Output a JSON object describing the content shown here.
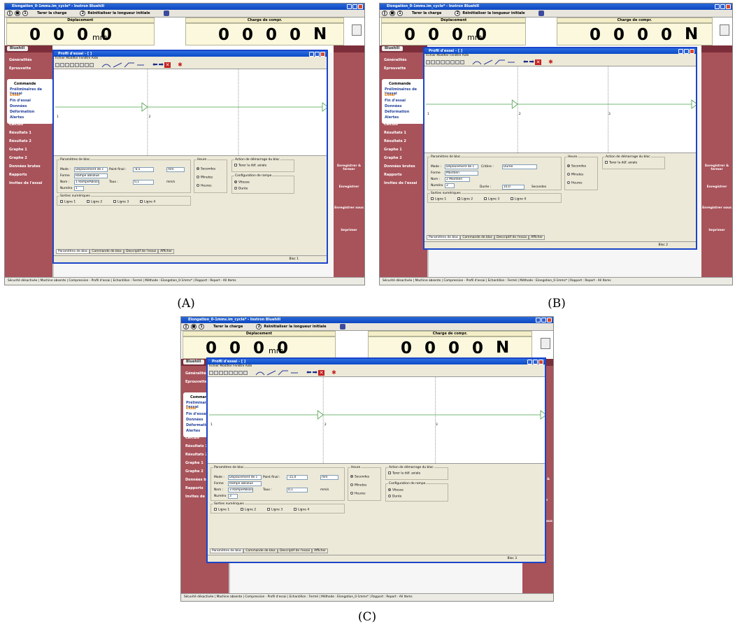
{
  "app": {
    "window_title": "Elongation_0-1mms.im_cycle* - Instron Bluehill",
    "toolbar": {
      "reset_load": "Tarer la charge",
      "reset_length": "Réinitialiser la longueur initiale",
      "step1": "1",
      "step2": "2"
    },
    "displacement": {
      "header": "Déplacement",
      "value": "0 0 0 0",
      "unit": "mm"
    },
    "load": {
      "header": "Charge de compr.",
      "value": "0 0 0 0",
      "unit": "N"
    },
    "nav": {
      "bluehill": "Bluehill",
      "items": [
        "Généralités",
        "Eprouvette",
        "Commande",
        "Calculs",
        "Résultats 1",
        "Résultats 2",
        "Graphe 1",
        "Graphe 2",
        "Données brutes",
        "Rapports",
        "Invites de l'essai"
      ],
      "subitems": [
        "Préliminaires de l'essai",
        "Essai",
        "Fin d'essai",
        "Données",
        "Déformation",
        "Alertes"
      ]
    },
    "right": {
      "save_close": "Enregistrer & fermer",
      "save": "Enregistrer",
      "save_as": "Enregistrer sous",
      "print": "Imprimer"
    },
    "status": "Sécurité désactivée  |  Machine absente  |  Compression - Profil d'essai  |  Echantillon : Fermé  |  Méthode : Elongation_0-1mms*  |  Rapport : Report - All Items"
  },
  "dialog": {
    "title": "Profil d'essai - [ ]",
    "menu": "Fichier   Modifier   Fenêtre   Aide",
    "params_legend": "Paramètres de bloc",
    "mode_label": "Mode :",
    "final_label": "Point final :",
    "forme_label": "Forme",
    "nom_label": "Nom :",
    "taux_label": "Taux :",
    "numero_label": "Numéro",
    "critere_label": "Critère :",
    "duree_label": "Durée :",
    "heure_legend": "Heure",
    "sec": "Secondes",
    "min": "Minutes",
    "hrs": "Heures",
    "action_legend": "Action de démarrage du bloc",
    "tare_chk": "Tarer la déf. axiale",
    "config_legend": "Configuration de rampe",
    "vitesse": "Vitesse",
    "duree": "Durée",
    "sorties_legend": "Sorties numériques",
    "lignes": [
      "Ligne 1",
      "Ligne 2",
      "Ligne 3",
      "Ligne 4"
    ],
    "tabs": [
      "Paramètres de bloc",
      "Commande de bloc",
      "Descriptif de l'essai",
      "Afficher"
    ],
    "mm_unit": "mm",
    "rate_unit": "mm/s",
    "sec_unit": "Secondes"
  },
  "panels": {
    "a": {
      "caption": "(A)",
      "mode": "Déplacement de c",
      "final": "-0,5",
      "forme": "Rampe absolue",
      "nom": "1 RampeAbsolue",
      "taux": "0,1",
      "numero": "1",
      "bloc": "Bloc 1",
      "chart_labels": [
        "1",
        "2"
      ]
    },
    "b": {
      "caption": "(B)",
      "mode": "Déplacement de c",
      "critere": "Durée",
      "forme": "Maintien",
      "nom": "2 Maintien",
      "duree": "10,0",
      "numero": "2",
      "bloc": "Bloc 2",
      "chart_labels": [
        "1",
        "2",
        "3"
      ]
    },
    "c": {
      "caption": "(C)",
      "mode": "Déplacement de c",
      "final": "-15,0",
      "forme": "Rampe absolue",
      "nom": "3 RampeAbsolue",
      "taux": "0,1",
      "numero": "3",
      "bloc": "Bloc 3",
      "chart_labels": [
        "1",
        "2",
        "3"
      ]
    }
  }
}
